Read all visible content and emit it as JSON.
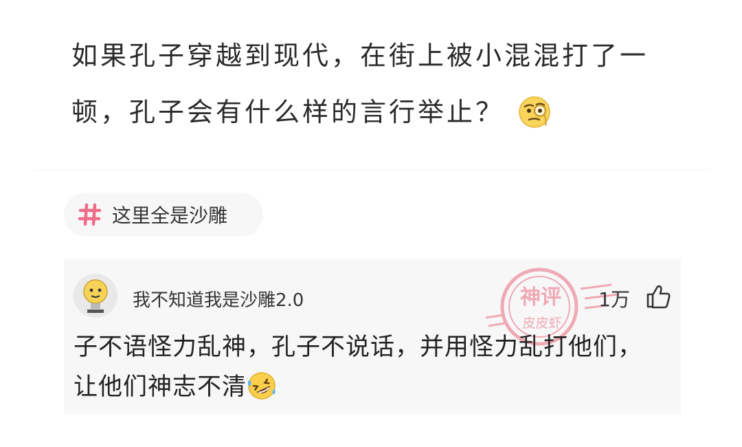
{
  "question": {
    "line1": "如果孔子穿越到现代，在街上被小混混打了一",
    "line2": "顿，孔子会有什么样的言行举止？",
    "emoji": "monocle-face"
  },
  "topic": {
    "label": "这里全是沙雕",
    "icon": "hash",
    "icon_color": "#f06b8b"
  },
  "comment": {
    "username": "我不知道我是沙雕2.0",
    "likes": "1万",
    "line1": "子不语怪力乱神，孔子不说话，并用怪力乱打他们，",
    "line2": "让他们神志不清",
    "emoji": "rolling-laughing"
  },
  "watermark": {
    "top": "神评",
    "bottom": "皮皮虾",
    "color": "#e96a7e"
  }
}
